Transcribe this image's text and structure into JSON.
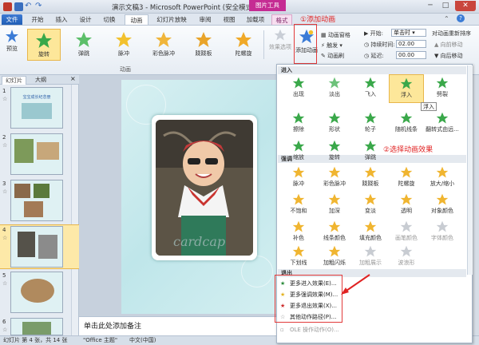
{
  "title_bar": {
    "title": "演示文稿3 - Microsoft PowerPoint (安全模式)",
    "picture_tools": "图片工具",
    "minimize": "─",
    "maximize": "□",
    "close": "✕"
  },
  "tabs": [
    "文件",
    "开始",
    "插入",
    "设计",
    "切换",
    "动画",
    "幻灯片放映",
    "审阅",
    "视图",
    "加载项",
    "格式"
  ],
  "ribbon": {
    "preview_label": "预览",
    "effects": [
      "旋转",
      "弹跳",
      "脉冲",
      "彩色脉冲",
      "跷跷板",
      "陀螺旋"
    ],
    "effect_options": "效果选项",
    "group_label": "动画",
    "add_animation": "添加动画",
    "animation_pane": "动画窗格",
    "trigger": "触发",
    "animation_painter": "动画刷",
    "start_label": "开始:",
    "start_value": "单击时",
    "duration_label": "持续时间:",
    "duration_value": "02.00",
    "delay_label": "延迟:",
    "delay_value": "00.00",
    "reorder_title": "对动画重新排序",
    "move_earlier": "向前移动",
    "move_later": "向后移动"
  },
  "left_pane": {
    "tab_slides": "幻灯片",
    "tab_outline": "大纲",
    "close": "×",
    "slides": [
      {
        "num": "1",
        "star": "☆"
      },
      {
        "num": "2",
        "star": "☆"
      },
      {
        "num": "3",
        "star": "☆"
      },
      {
        "num": "4",
        "star": "☆"
      },
      {
        "num": "5",
        "star": "☆"
      },
      {
        "num": "6",
        "star": "☆"
      }
    ],
    "thumb1_text": "宝宝成长纪念册"
  },
  "slide": {
    "photo_caption": "cardcap"
  },
  "notes": {
    "placeholder": "单击此处添加备注"
  },
  "status": {
    "slide_info": "幻灯片 第 4 张，共 14 张",
    "theme": "\"Office 主题\"",
    "language": "中文(中国)"
  },
  "dropdown": {
    "entrance_header": "进入",
    "entrance": [
      "出现",
      "淡出",
      "飞入",
      "浮入",
      "劈裂",
      "擦除",
      "形状",
      "轮子",
      "随机线条",
      "翻转式由远...",
      "缩放",
      "旋转",
      "弹跳"
    ],
    "emphasis_header": "强调",
    "emphasis": [
      "脉冲",
      "彩色脉冲",
      "跷跷板",
      "陀螺旋",
      "放大/缩小",
      "不饱和",
      "加深",
      "变淡",
      "透明",
      "对象颜色",
      "补色",
      "线条颜色",
      "填充颜色",
      "画笔颜色",
      "字体颜色",
      "下划线",
      "加粗闪烁",
      "加粗展示",
      "波浪形"
    ],
    "exit_header": "退出",
    "more_entrance": "更多进入效果(E)...",
    "more_emphasis": "更多强调效果(M)...",
    "more_exit": "更多退出效果(X)...",
    "more_motion": "其他动作路径(P)...",
    "ole": "OLE 操作动作(O)...",
    "tooltip": "浮入"
  },
  "annotations": {
    "step1": "①添加动画",
    "step2": "②选择动画效果"
  },
  "colors": {
    "accent_red": "#e02222",
    "selected": "#fde79a",
    "file_tab": "#2c6ac7",
    "picture_tools": "#c52c93"
  }
}
